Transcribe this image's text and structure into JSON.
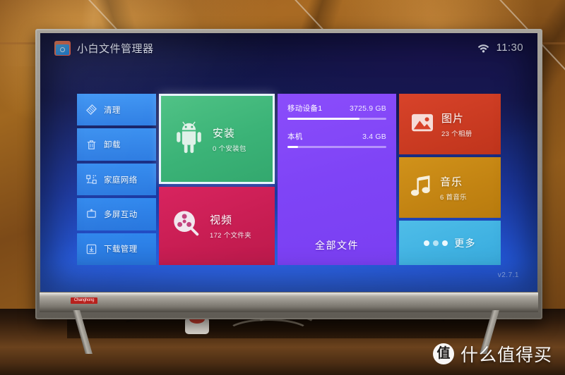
{
  "app": {
    "title": "小白文件管理器",
    "icon": "folder-camera-icon",
    "version": "v2.7.1"
  },
  "statusbar": {
    "wifi_icon": "wifi-icon",
    "clock": "11:30"
  },
  "sidebar": {
    "items": [
      {
        "label": "清理",
        "icon": "broom-icon"
      },
      {
        "label": "卸载",
        "icon": "trash-icon"
      },
      {
        "label": "家庭网络",
        "icon": "network-icon"
      },
      {
        "label": "多屏互动",
        "icon": "screen-share-icon"
      },
      {
        "label": "下载管理",
        "icon": "download-icon"
      }
    ]
  },
  "tiles": {
    "install": {
      "label": "安装",
      "sub": "0 个安装包",
      "icon": "android-robot-icon",
      "color": "#3bb377",
      "selected": true
    },
    "video": {
      "label": "视频",
      "sub": "172 个文件夹",
      "icon": "film-reel-icon",
      "color": "#c71d52"
    },
    "pictures": {
      "label": "图片",
      "sub": "23 个相册",
      "icon": "photo-icon",
      "color": "#c93a21"
    },
    "music": {
      "label": "音乐",
      "sub": "6 首音乐",
      "icon": "music-note-icon",
      "color": "#c28312"
    },
    "more": {
      "label": "更多",
      "icon": "three-dots-icon",
      "color": "#40b2e2"
    }
  },
  "storage_panel": {
    "all_files_label": "全部文件",
    "color": "#7f44f6",
    "devices": [
      {
        "name": "移动设备1",
        "size": "3725.9 GB",
        "fill_percent": 73
      },
      {
        "name": "本机",
        "size": "3.4 GB",
        "fill_percent": 11
      }
    ]
  },
  "tv": {
    "brand": "Changhong"
  },
  "watermark": {
    "badge": "值",
    "text": "什么值得买"
  }
}
